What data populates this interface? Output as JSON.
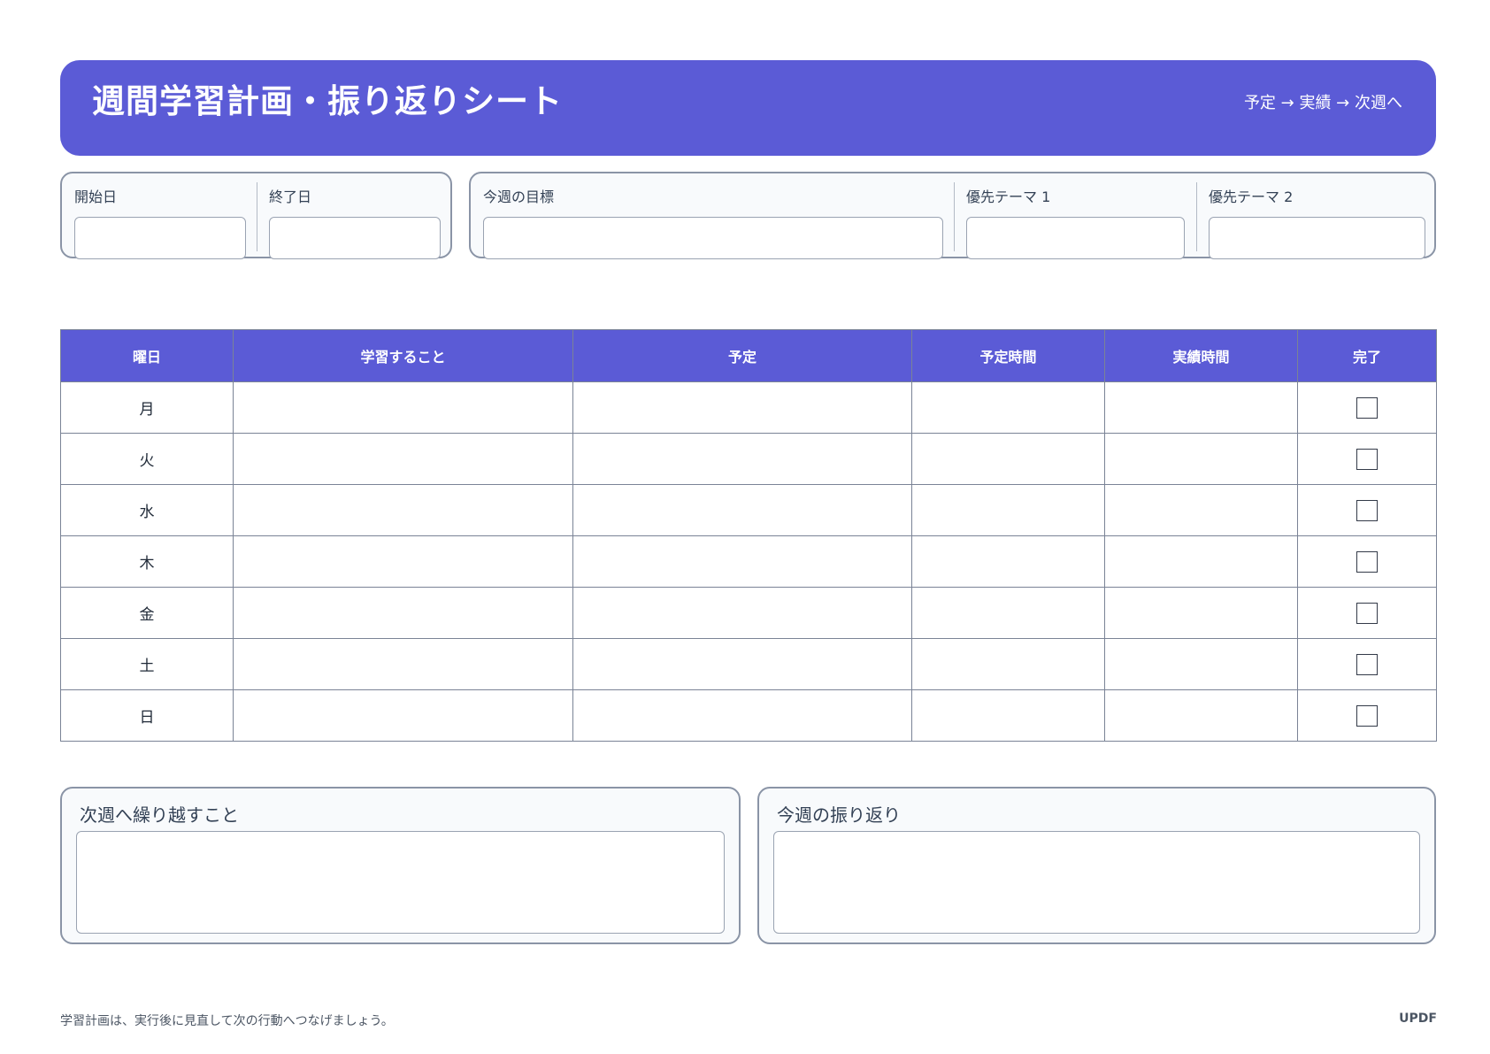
{
  "header": {
    "title": "週間学習計画・振り返りシート",
    "flow": "予定 → 実績 → 次週へ"
  },
  "dates": {
    "start_label": "開始日",
    "end_label": "終了日"
  },
  "goals": {
    "goal_label": "今週の目標",
    "theme1_label": "優先テーマ 1",
    "theme2_label": "優先テーマ 2"
  },
  "table": {
    "columns": [
      "曜日",
      "学習すること",
      "予定",
      "予定時間",
      "実績時間",
      "完了"
    ],
    "days": [
      "月",
      "火",
      "水",
      "木",
      "金",
      "土",
      "日"
    ]
  },
  "carryover": {
    "label": "次週へ繰り越すこと"
  },
  "reflection": {
    "label": "今週の振り返り"
  },
  "footer": {
    "note": "学習計画は、実行後に見直して次の行動へつなげましょう。",
    "brand": "UPDF"
  },
  "colors": {
    "accent": "#5b5bd6",
    "border": "#8a94a6",
    "panel_bg": "#f8fafc"
  }
}
